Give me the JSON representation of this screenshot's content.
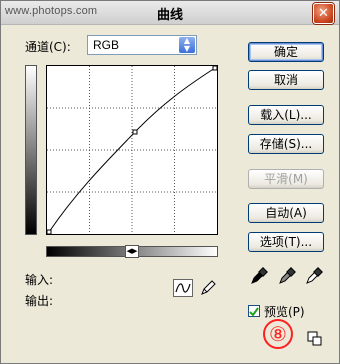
{
  "window": {
    "watermark": "www.photops.com",
    "title": "曲线",
    "close_glyph": "✕"
  },
  "channel": {
    "label": "通道(C):",
    "value": "RGB"
  },
  "buttons": {
    "ok": "确定",
    "cancel": "取消",
    "load": "载入(L)...",
    "save": "存储(S)...",
    "smooth": "平滑(M)",
    "auto": "自动(A)",
    "options": "选项(T)..."
  },
  "io": {
    "input_label": "输入:",
    "output_label": "输出:"
  },
  "preview": {
    "label": "预览(P)",
    "checked": true
  },
  "annotation": {
    "text": "⑧"
  },
  "icons": {
    "eyedroppers": [
      "black-point-eyedropper-icon",
      "gray-point-eyedropper-icon",
      "white-point-eyedropper-icon"
    ],
    "curve_tool": "curve-tool-icon",
    "pencil_tool": "pencil-tool-icon",
    "resize": "resize-icon"
  },
  "colors": {
    "dialog_bg": "#ece9d8",
    "button_border": "#003c74",
    "annotation": "#ff2020"
  }
}
